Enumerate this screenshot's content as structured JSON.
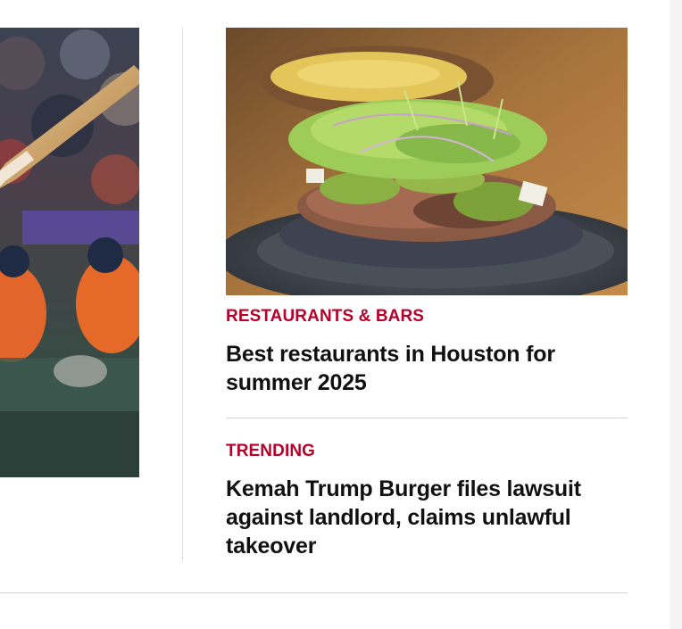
{
  "stories": [
    {
      "kicker": "RESTAURANTS & BARS",
      "headline": "Best restaurants in Houston for summer 2025"
    },
    {
      "kicker": "TRENDING",
      "headline": "Kemah Trump Burger files lawsuit against landlord, claims unlawful takeover"
    }
  ],
  "colors": {
    "kicker": "#b8002b",
    "headline": "#111111",
    "divider": "#d2d2d2"
  }
}
